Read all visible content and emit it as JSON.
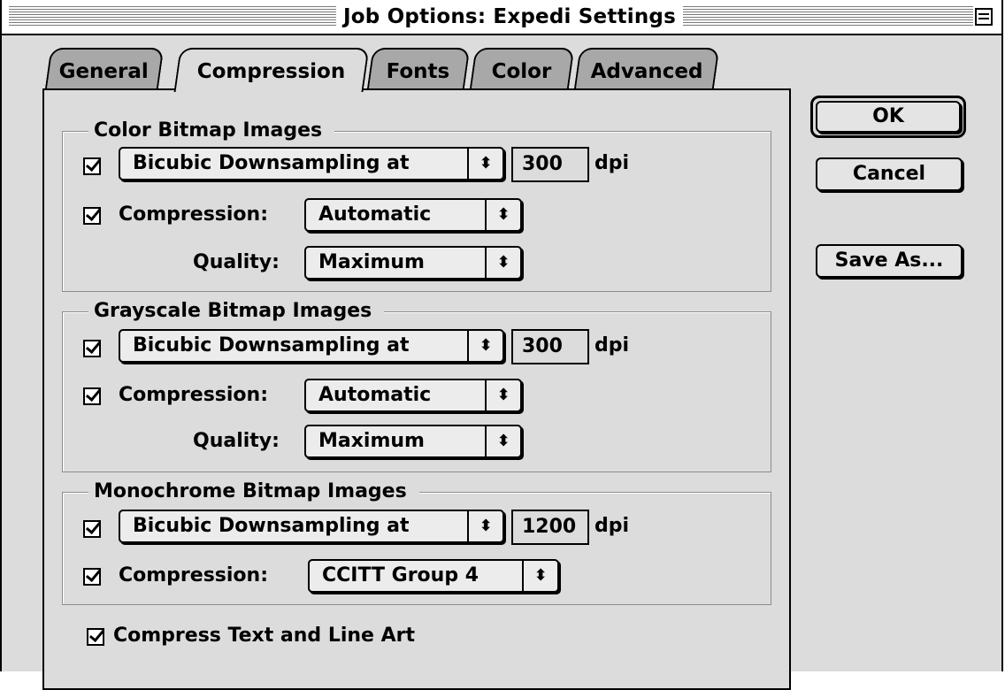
{
  "window": {
    "title": "Job Options: Expedi Settings"
  },
  "tabs": [
    {
      "label": "General",
      "active": false
    },
    {
      "label": "Compression",
      "active": true
    },
    {
      "label": "Fonts",
      "active": false
    },
    {
      "label": "Color",
      "active": false
    },
    {
      "label": "Advanced",
      "active": false
    }
  ],
  "groups": {
    "color": {
      "title": "Color Bitmap Images",
      "downsample": {
        "checked": true,
        "value": "Bicubic Downsampling at",
        "dpi": "300",
        "dpi_unit": "dpi"
      },
      "compression": {
        "checked": true,
        "label": "Compression:",
        "value": "Automatic"
      },
      "quality": {
        "label": "Quality:",
        "value": "Maximum"
      }
    },
    "grayscale": {
      "title": "Grayscale Bitmap Images",
      "downsample": {
        "checked": true,
        "value": "Bicubic Downsampling at",
        "dpi": "300",
        "dpi_unit": "dpi"
      },
      "compression": {
        "checked": true,
        "label": "Compression:",
        "value": "Automatic"
      },
      "quality": {
        "label": "Quality:",
        "value": "Maximum"
      }
    },
    "monochrome": {
      "title": "Monochrome Bitmap Images",
      "downsample": {
        "checked": true,
        "value": "Bicubic Downsampling at",
        "dpi": "1200",
        "dpi_unit": "dpi"
      },
      "compression": {
        "checked": true,
        "label": "Compression:",
        "value": "CCITT Group 4"
      }
    }
  },
  "compress_text": {
    "checked": true,
    "label": "Compress Text and Line Art"
  },
  "buttons": {
    "ok": "OK",
    "cancel": "Cancel",
    "save_as": "Save As..."
  },
  "icons": {
    "popup_arrow": "⬍"
  }
}
